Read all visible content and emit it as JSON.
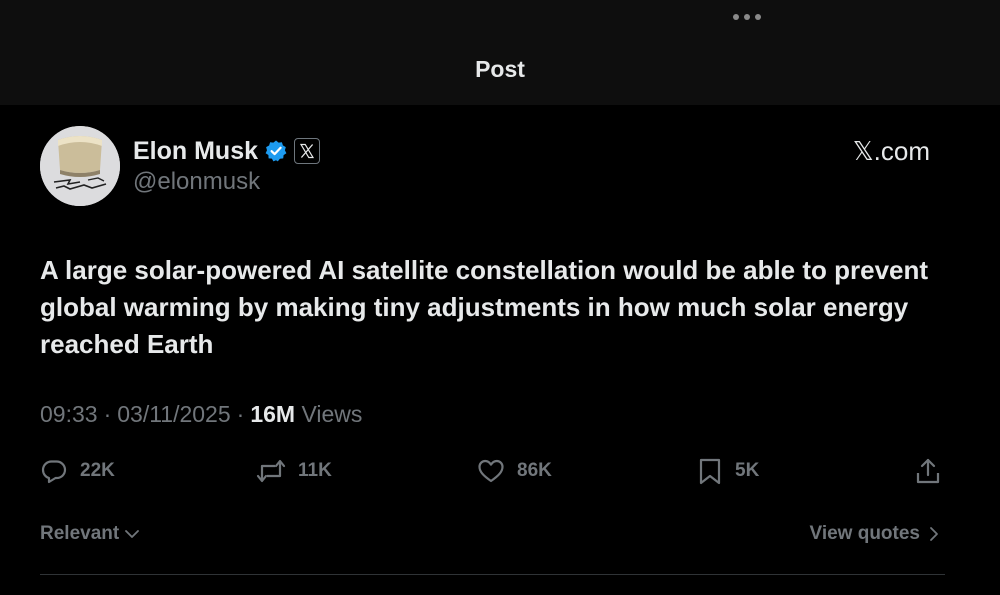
{
  "header": {
    "title": "Post",
    "more_icon": "more-horizontal-icon"
  },
  "author": {
    "name": "Elon Musk",
    "handle": "@elonmusk",
    "verified_color": "#1d9bf0",
    "affiliation_badge": "𝕏",
    "affiliation_label": "𝕏.com"
  },
  "post": {
    "text": "A large solar-powered AI satellite constellation would be able to prevent global warming by making tiny adjustments in how much solar energy reached Earth",
    "time": "09:33",
    "date": "03/11/2025",
    "separator": "·",
    "views_count": "16M",
    "views_label": "Views"
  },
  "actions": {
    "replies": "22K",
    "reposts": "11K",
    "likes": "86K",
    "bookmarks": "5K"
  },
  "footer": {
    "sort_label": "Relevant",
    "quotes_label": "View quotes"
  },
  "colors": {
    "background": "#000000",
    "header_bg": "#0e0e0e",
    "muted": "#71767b",
    "text": "#e7e9ea"
  }
}
